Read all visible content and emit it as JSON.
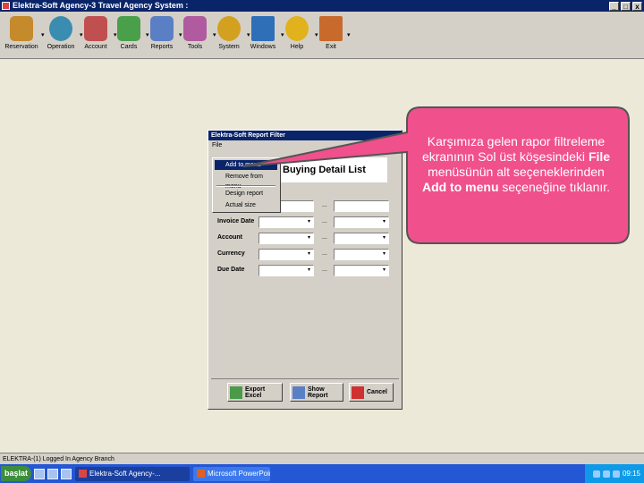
{
  "window": {
    "title": "Elektra-Soft Agency-3 Travel Agency System :",
    "min_label": "_",
    "max_label": "□",
    "close_label": "x"
  },
  "toolbar": {
    "items": [
      {
        "label": "Reservation",
        "color": "#c48a2c"
      },
      {
        "label": "Operation",
        "color": "#3a8db0"
      },
      {
        "label": "Account",
        "color": "#c05050"
      },
      {
        "label": "Cards",
        "color": "#4aa04a"
      },
      {
        "label": "Reports",
        "color": "#5a7fc4"
      },
      {
        "label": "Tools",
        "color": "#b05aa0"
      },
      {
        "label": "System",
        "color": "#d4a020"
      },
      {
        "label": "Windows",
        "color": "#2f6fb8"
      },
      {
        "label": "Help",
        "color": "#e2b21c"
      },
      {
        "label": "Exit",
        "color": "#c86a2c"
      }
    ],
    "arrow": "▾"
  },
  "dialog": {
    "title": "Elektra-Soft Report Filter",
    "menu_file": "File",
    "report_title": "Buying Detail List",
    "filters": [
      {
        "label": "",
        "dots": "..."
      },
      {
        "label": "Invoice Date",
        "dots": "..."
      },
      {
        "label": "Account",
        "dots": "..."
      },
      {
        "label": "Currency",
        "dots": "..."
      },
      {
        "label": "Due Date",
        "dots": "..."
      }
    ],
    "combo_arrow": "▾",
    "buttons": {
      "export": "Export Excel",
      "show": "Show Report",
      "cancel": "Cancel"
    }
  },
  "file_menu": {
    "items": [
      "Add to menu",
      "Remove from menu",
      "Design report",
      "Actual size"
    ]
  },
  "callout": {
    "text_1": "Karşımıza gelen rapor filtreleme ekranının Sol üst köşesindeki ",
    "bold_1": "File",
    "text_2": " menüsünün alt seçeneklerinden ",
    "bold_2": "Add to menu",
    "text_3": " seçeneğine tıklanır.",
    "fill": "#f0508c",
    "border": "#555555"
  },
  "statusbar": {
    "text": "ELEKTRA-(1) Logged In Agency Branch"
  },
  "taskbar": {
    "start_label": "başlat",
    "tasks": [
      {
        "label": "Elektra-Soft Agency-..."
      },
      {
        "label": "Microsoft PowerPoint - [..."
      }
    ],
    "clock": "09:15"
  },
  "colors": {
    "titlebar": "#0a246a",
    "taskbar": "#2457d3"
  }
}
